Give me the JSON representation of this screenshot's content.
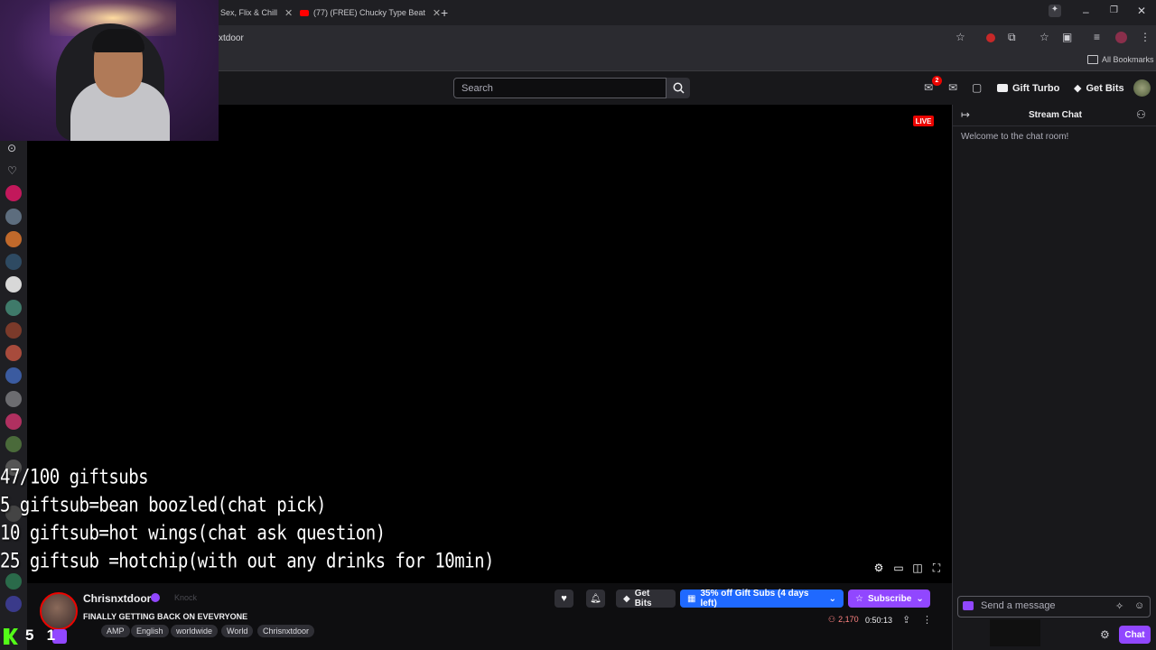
{
  "browser": {
    "tabs": [
      {
        "label": "Sex, Flix & Chill"
      },
      {
        "label": "(77) (FREE) Chucky Type Beat"
      }
    ],
    "address": "xtdoor",
    "bookmarks_label": "All Bookmarks"
  },
  "topnav": {
    "search_placeholder": "Search",
    "notification_count": "2",
    "gift_turbo": "Gift Turbo",
    "get_bits": "Get Bits"
  },
  "player": {
    "live_badge": "LIVE",
    "overlay_lines": [
      "47/100 giftsubs",
      "5 giftsub=bean boozled(chat pick)",
      "10 giftsub=hot wings(chat ask question)",
      "25 giftsub =hotchip(with out any drinks for 10min)"
    ]
  },
  "channel": {
    "name": "Chrisnxtdoor",
    "faded_label": "Knock",
    "title": "FINALLY GETTING BACK ON EVEVRYONE",
    "tags": [
      "AMP",
      "English",
      "worldwide",
      "World",
      "Chrisnxtdoor"
    ],
    "get_bits": "Get Bits",
    "gift_subs": "35% off Gift Subs (4 days left)",
    "subscribe": "Subscribe",
    "viewers": "2,170",
    "uptime": "0:50:13",
    "corner_overlay": "5   1"
  },
  "chat": {
    "title": "Stream Chat",
    "welcome": "Welcome to the chat room!",
    "send_placeholder": "Send a message",
    "chat_button": "Chat"
  },
  "colors": {
    "accent": "#9147ff",
    "live_red": "#eb0400",
    "gift_blue": "#1f69ff"
  }
}
